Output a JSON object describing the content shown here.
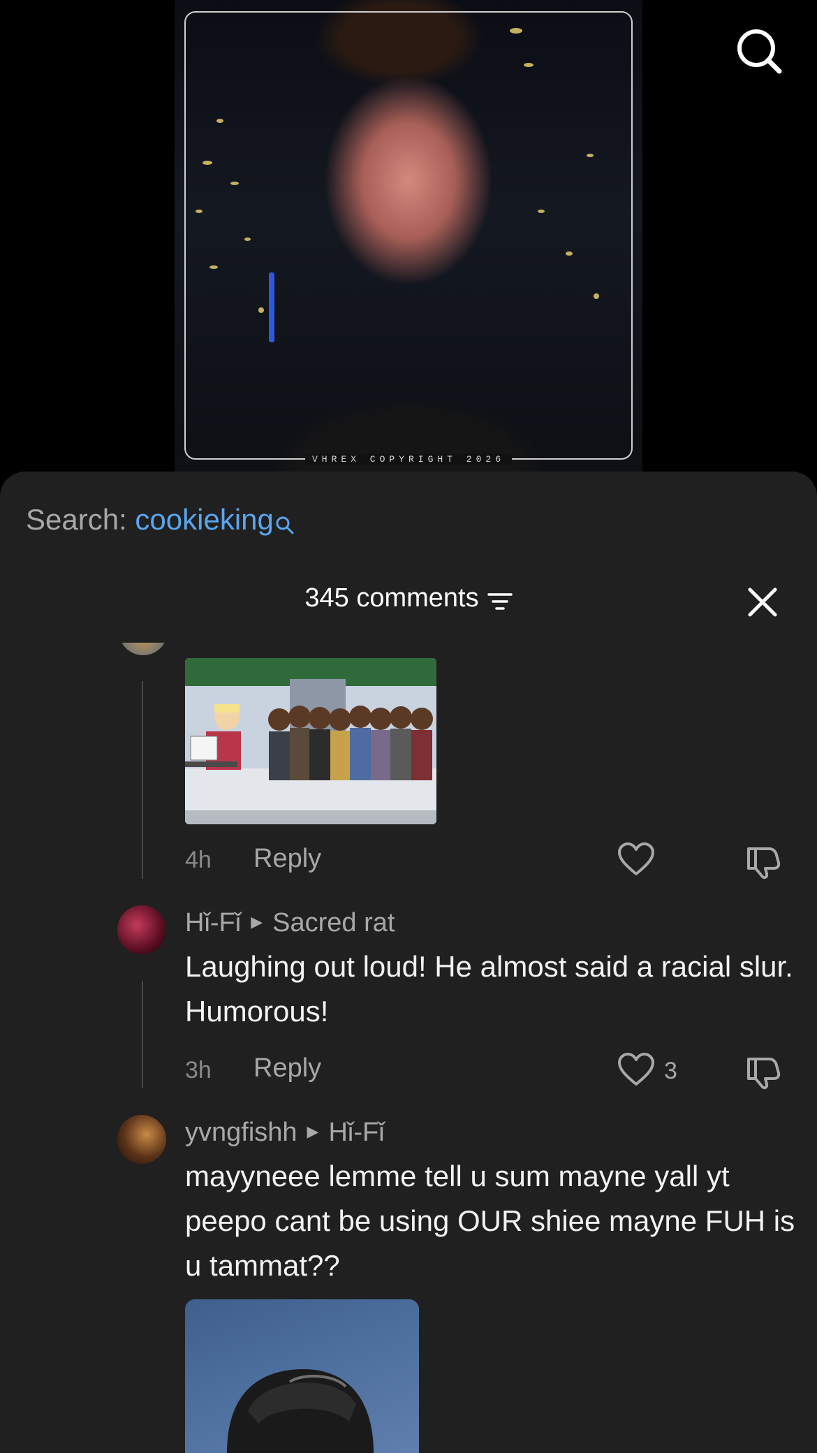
{
  "video": {
    "watermark": "VHREX COPYRIGHT 2026",
    "search_icon": "search-icon"
  },
  "sheet": {
    "search_label": "Search: ",
    "search_term": "cookieking",
    "comments_count": "345 comments",
    "filter_icon": "filter-icon",
    "close_icon": "close-icon"
  },
  "comments": [
    {
      "time": "4h",
      "reply_label": "Reply",
      "like_count": "",
      "media": "cartoon-gif"
    },
    {
      "author": "Hǐ-Fǐ",
      "reply_to": "Sacred rat",
      "text": "Laughing out loud! He almost said a racial slur. Humorous!",
      "time": "3h",
      "reply_label": "Reply",
      "like_count": "3"
    },
    {
      "author": "yvngfishh",
      "reply_to": "Hǐ-Fǐ",
      "text": "mayyneee lemme tell u sum mayne yall yt peepo cant be using OUR shiee mayne FUH is u tammat??",
      "media": "photo-thumbnail"
    }
  ],
  "colors": {
    "sheet_bg": "#202020",
    "link_blue": "#5aa5ef",
    "muted_text": "#a8a8a8"
  }
}
